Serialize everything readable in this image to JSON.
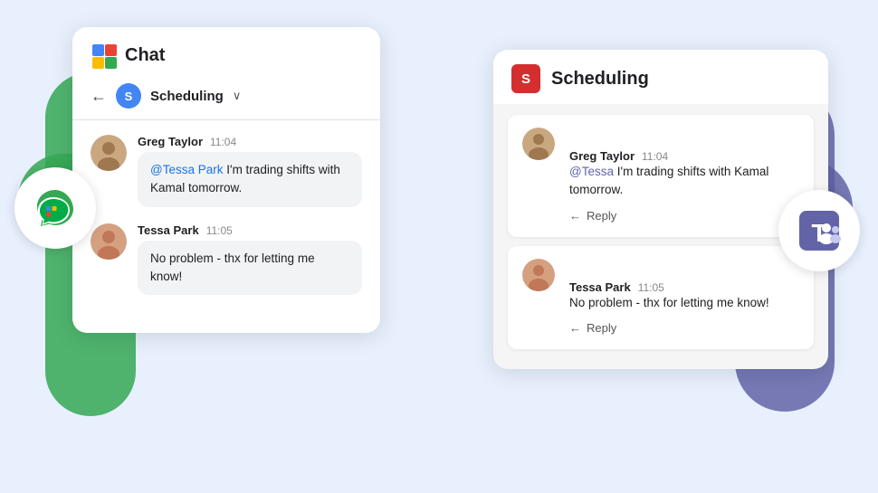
{
  "background_color": "#e8f0fe",
  "google_chat": {
    "app_name": "Chat",
    "group_name": "Scheduling",
    "messages": [
      {
        "sender": "Greg Taylor",
        "time": "11:04",
        "text": "@Tessa Park I'm trading shifts with Kamal tomorrow.",
        "mention": "@Tessa Park",
        "avatar": "greg"
      },
      {
        "sender": "Tessa Park",
        "time": "11:05",
        "text": "No problem - thx for letting me know!",
        "mention": null,
        "avatar": "tessa"
      }
    ]
  },
  "microsoft_teams": {
    "app_name": "Scheduling",
    "messages": [
      {
        "sender": "Greg Taylor",
        "time": "11:04",
        "text": "@Tessa I'm trading shifts with Kamal tomorrow.",
        "mention": "@Tessa",
        "reply_label": "Reply",
        "avatar": "greg"
      },
      {
        "sender": "Tessa Park",
        "time": "11:05",
        "text": "No problem - thx for letting me know!",
        "mention": null,
        "reply_label": "Reply",
        "avatar": "tessa"
      }
    ]
  },
  "icons": {
    "back_arrow": "←",
    "reply_arrow": "←",
    "dropdown": "∨"
  }
}
